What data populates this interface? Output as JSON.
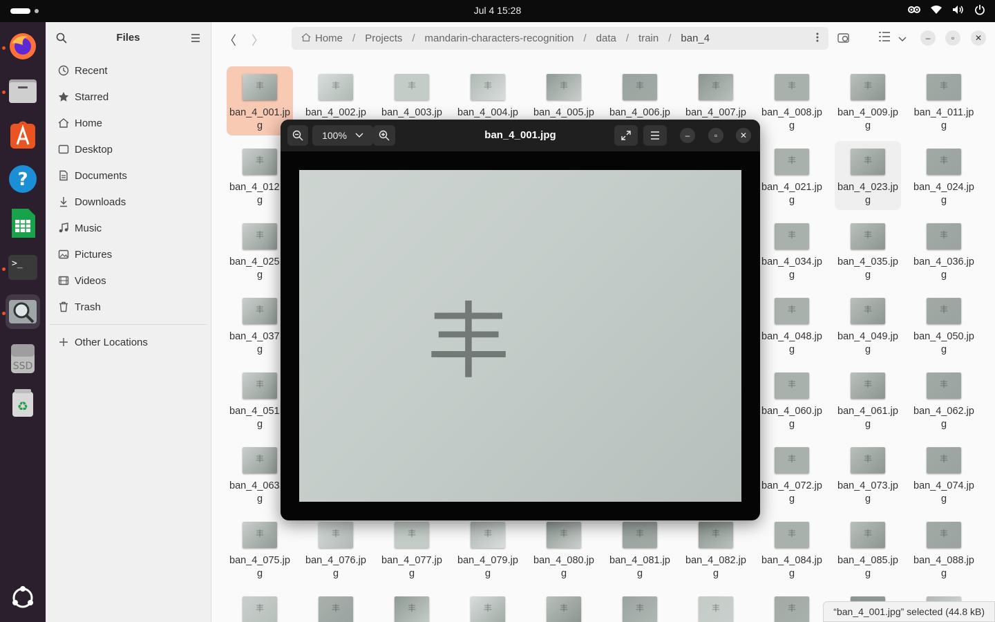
{
  "topbar": {
    "clock": "Jul 4  15:28"
  },
  "sidebar": {
    "title": "Files",
    "items": [
      {
        "label": "Recent",
        "icon": "clock-icon"
      },
      {
        "label": "Starred",
        "icon": "star-icon"
      },
      {
        "label": "Home",
        "icon": "home-icon"
      },
      {
        "label": "Desktop",
        "icon": "desktop-icon"
      },
      {
        "label": "Documents",
        "icon": "document-icon"
      },
      {
        "label": "Downloads",
        "icon": "download-icon"
      },
      {
        "label": "Music",
        "icon": "music-icon"
      },
      {
        "label": "Pictures",
        "icon": "picture-icon"
      },
      {
        "label": "Videos",
        "icon": "video-icon"
      },
      {
        "label": "Trash",
        "icon": "trash-icon"
      }
    ],
    "other": "Other Locations"
  },
  "breadcrumb": [
    "Home",
    "Projects",
    "mandarin-characters-recognition",
    "data",
    "train",
    "ban_4"
  ],
  "files": [
    "ban_4_001.jpg",
    "ban_4_002.jpg",
    "ban_4_003.jpg",
    "ban_4_004.jpg",
    "ban_4_005.jpg",
    "ban_4_006.jpg",
    "ban_4_007.jpg",
    "ban_4_008.jpg",
    "ban_4_009.jpg",
    "ban_4_011.jpg",
    "ban_4_012.jpg",
    "",
    "",
    "",
    "",
    "",
    "",
    "ban_4_021.jpg",
    "ban_4_023.jpg",
    "ban_4_024.jpg",
    "ban_4_025.jpg",
    "",
    "",
    "",
    "",
    "",
    "",
    "ban_4_034.jpg",
    "ban_4_035.jpg",
    "ban_4_036.jpg",
    "ban_4_037.jpg",
    "",
    "",
    "",
    "",
    "",
    "",
    "ban_4_048.jpg",
    "ban_4_049.jpg",
    "ban_4_050.jpg",
    "ban_4_051.jpg",
    "",
    "",
    "",
    "",
    "",
    "",
    "ban_4_060.jpg",
    "ban_4_061.jpg",
    "ban_4_062.jpg",
    "ban_4_063.jpg",
    "",
    "",
    "",
    "",
    "",
    "",
    "ban_4_072.jpg",
    "ban_4_073.jpg",
    "ban_4_074.jpg",
    "ban_4_075.jpg",
    "ban_4_076.jpg",
    "ban_4_077.jpg",
    "ban_4_079.jpg",
    "ban_4_080.jpg",
    "ban_4_081.jpg",
    "ban_4_082.jpg",
    "ban_4_084.jpg",
    "ban_4_085.jpg",
    "ban_4_088.jpg"
  ],
  "status": "“ban_4_001.jpg” selected  (44.8 kB)",
  "viewer": {
    "title": "ban_4_001.jpg",
    "zoom": "100%",
    "character": "丰"
  }
}
